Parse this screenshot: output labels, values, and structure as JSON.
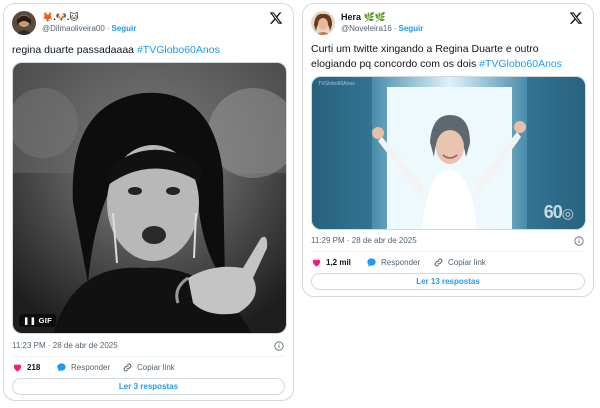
{
  "tweets": [
    {
      "author": {
        "name": "🦊.🐶.🐱",
        "handle": "@Dilmaoliveira00",
        "follow_label": "Seguir"
      },
      "text": "regina duarte passadaaaa ",
      "hashtag": "#TVGlobo60Anos",
      "media": {
        "badge": "GIF",
        "pause_icon": "pause-icon"
      },
      "timestamp": "11:23 PM · 28 de abr de 2025",
      "likes": "218",
      "reply_label": "Responder",
      "copy_label": "Copiar link",
      "read_replies_label": "Ler 3 respostas"
    },
    {
      "author": {
        "name": "Hera 🌿🌿",
        "handle": "@Noveleira16",
        "follow_label": "Seguir"
      },
      "text_line1": "Curti um twitte xingando a Regina Duarte e outro",
      "text_line2": "elogiando pq concordo com os dois ",
      "hashtag": "#TVGlobo60Anos",
      "media": {
        "watermark": "60",
        "corner_text": "TVGlobo60Anos"
      },
      "timestamp": "11:29 PM · 28 de abr de 2025",
      "likes": "1,2 mil",
      "reply_label": "Responder",
      "copy_label": "Copiar link",
      "read_replies_label": "Ler 13 respostas"
    }
  ],
  "colors": {
    "link": "#1d9bf0",
    "like": "#f91880",
    "muted": "#536471",
    "border": "#cfd9de"
  },
  "icons": [
    "x-logo-icon",
    "heart-icon",
    "reply-bubble-icon",
    "link-icon",
    "info-icon",
    "pause-icon"
  ]
}
